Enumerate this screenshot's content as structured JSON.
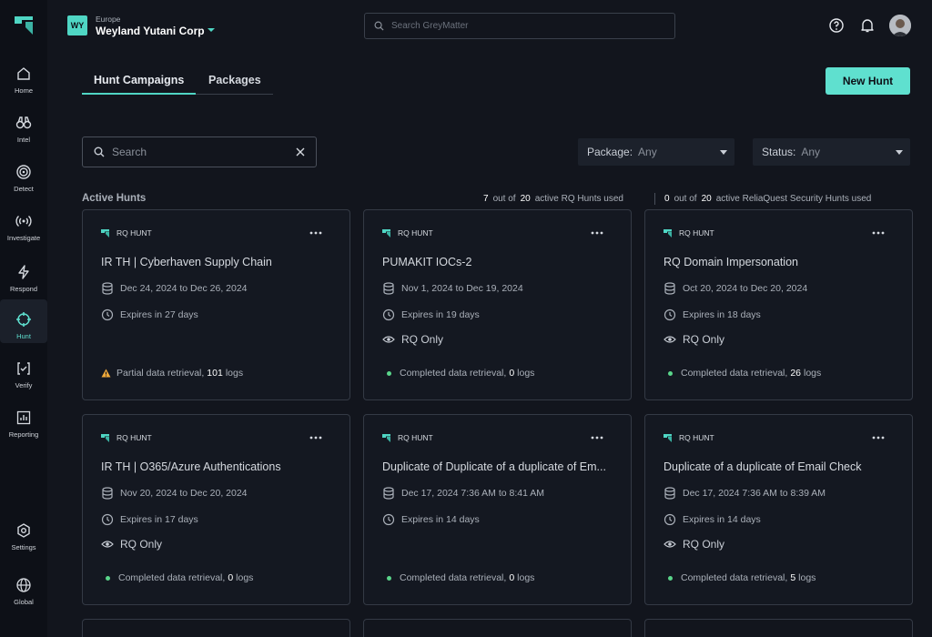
{
  "nav": [
    {
      "label": "Home",
      "icon": "home-icon"
    },
    {
      "label": "Intel",
      "icon": "binoculars-icon"
    },
    {
      "label": "Detect",
      "icon": "target-icon"
    },
    {
      "label": "Investigate",
      "icon": "signal-icon"
    },
    {
      "label": "Respond",
      "icon": "lightning-icon"
    },
    {
      "label": "Hunt",
      "icon": "crosshair-icon",
      "active": true
    },
    {
      "label": "Verify",
      "icon": "verify-icon"
    },
    {
      "label": "Reporting",
      "icon": "chart-icon"
    },
    {
      "label": "Settings",
      "icon": "gear-icon"
    },
    {
      "label": "Global",
      "icon": "globe-icon"
    }
  ],
  "org": {
    "badge": "WY",
    "region": "Europe",
    "name": "Weyland Yutani Corp"
  },
  "global_search": {
    "placeholder": "Search GreyMatter"
  },
  "tabs": [
    {
      "label": "Hunt Campaigns"
    },
    {
      "label": "Packages"
    }
  ],
  "actions": {
    "new_hunt": "New Hunt"
  },
  "filters": {
    "search_placeholder": "Search",
    "package_label": "Package:",
    "package_value": "Any",
    "status_label": "Status:",
    "status_value": "Any"
  },
  "section": {
    "title": "Active Hunts"
  },
  "usage": {
    "rq_used": "7",
    "rq_of": "out of",
    "rq_total": "20",
    "rq_text": "active RQ Hunts used",
    "sec_used": "0",
    "sec_of": "out of",
    "sec_total": "20",
    "sec_text": "active ReliaQuest Security Hunts used"
  },
  "colors": {
    "accent": "#5fe0cf",
    "success": "#5ad58a",
    "warning": "#f0a93a",
    "background": "#12151d"
  },
  "cards": [
    {
      "type": "RQ HUNT",
      "title": "IR TH | Cyberhaven Supply Chain",
      "dates": "Dec 24, 2024 to Dec 26, 2024",
      "expires": "Expires in 27 days",
      "rq_only": "",
      "status_icon": "warning",
      "status_text": "Partial data retrieval,",
      "logs": "101",
      "logs_word": "logs"
    },
    {
      "type": "RQ HUNT",
      "title": "PUMAKIT IOCs-2",
      "dates": "Nov 1, 2024 to Dec 19, 2024",
      "expires": "Expires in 19 days",
      "rq_only": "RQ Only",
      "status_icon": "success",
      "status_text": "Completed data retrieval,",
      "logs": "0",
      "logs_word": "logs"
    },
    {
      "type": "RQ HUNT",
      "title": "RQ Domain Impersonation",
      "dates": "Oct 20, 2024 to Dec 20, 2024",
      "expires": "Expires in 18 days",
      "rq_only": "RQ Only",
      "status_icon": "success",
      "status_text": "Completed data retrieval,",
      "logs": "26",
      "logs_word": "logs"
    },
    {
      "type": "RQ HUNT",
      "title": "IR TH | O365/Azure Authentications",
      "dates": "Nov 20, 2024 to Dec 20, 2024",
      "expires": "Expires in 17 days",
      "rq_only": "RQ Only",
      "status_icon": "success",
      "status_text": "Completed data retrieval,",
      "logs": "0",
      "logs_word": "logs"
    },
    {
      "type": "RQ HUNT",
      "title": "Duplicate of Duplicate of a duplicate of Em...",
      "dates": "Dec 17, 2024 7:36 AM to 8:41 AM",
      "expires": "Expires in 14 days",
      "rq_only": "",
      "status_icon": "success",
      "status_text": "Completed data retrieval,",
      "logs": "0",
      "logs_word": "logs"
    },
    {
      "type": "RQ HUNT",
      "title": "Duplicate of a duplicate of Email Check",
      "dates": "Dec 17, 2024 7:36 AM to 8:39 AM",
      "expires": "Expires in 14 days",
      "rq_only": "RQ Only",
      "status_icon": "success",
      "status_text": "Completed data retrieval,",
      "logs": "5",
      "logs_word": "logs"
    }
  ]
}
